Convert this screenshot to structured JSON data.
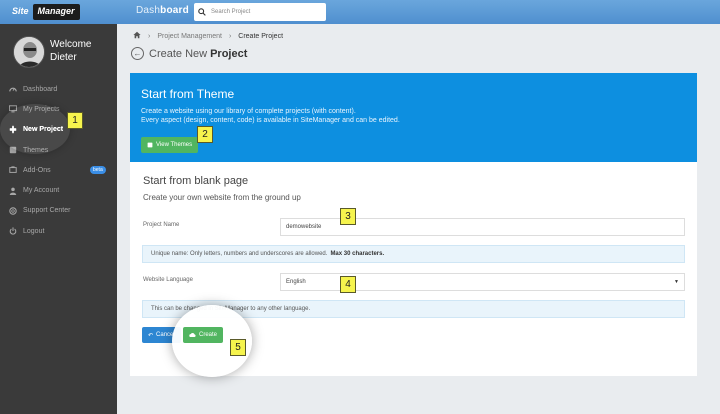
{
  "app": {
    "logo_part1": "Site",
    "logo_part2": "Manager"
  },
  "header": {
    "title_light": "Dash",
    "title_bold": "board",
    "search_placeholder": "Search Project"
  },
  "user": {
    "welcome": "Welcome",
    "name": "Dieter"
  },
  "sidebar": {
    "items": [
      {
        "label": "Dashboard",
        "icon": "dashboard-icon"
      },
      {
        "label": "My Projects",
        "icon": "monitor-icon"
      },
      {
        "label": "New Project",
        "icon": "plus-icon",
        "active": true
      },
      {
        "label": "Themes",
        "icon": "themes-icon"
      },
      {
        "label": "Add-Ons",
        "icon": "addons-icon",
        "badge": "beta"
      },
      {
        "label": "My Account",
        "icon": "user-icon"
      },
      {
        "label": "Support Center",
        "icon": "support-icon"
      },
      {
        "label": "Logout",
        "icon": "power-icon"
      }
    ]
  },
  "breadcrumb": {
    "items": [
      "Project Management",
      "Create Project"
    ]
  },
  "page": {
    "title_light": "Create New",
    "title_bold": "Project"
  },
  "theme_panel": {
    "title": "Start from Theme",
    "line1": "Create a website using our library of complete projects (with content).",
    "line2": "Every aspect (design, content, code) is available in SiteManager and can be edited.",
    "button": "View Themes"
  },
  "blank_panel": {
    "title": "Start from blank page",
    "subtitle": "Create your own website from the ground up",
    "project_name_label": "Project Name",
    "project_name_value": "demowebsite",
    "name_info": "Unique name: Only letters, numbers and underscores are allowed.",
    "name_info_bold": "Max 30 characters.",
    "language_label": "Website Language",
    "language_value": "English",
    "language_info": "This can be changed in SiteManager to any other language.",
    "cancel_button": "Cancel",
    "create_button": "Create"
  },
  "steps": [
    "1",
    "2",
    "3",
    "4",
    "5"
  ],
  "colors": {
    "accent_blue": "#0d8fe0",
    "green": "#51b560",
    "sidebar": "#3a3a3a",
    "step_badge": "#f6f44d"
  }
}
